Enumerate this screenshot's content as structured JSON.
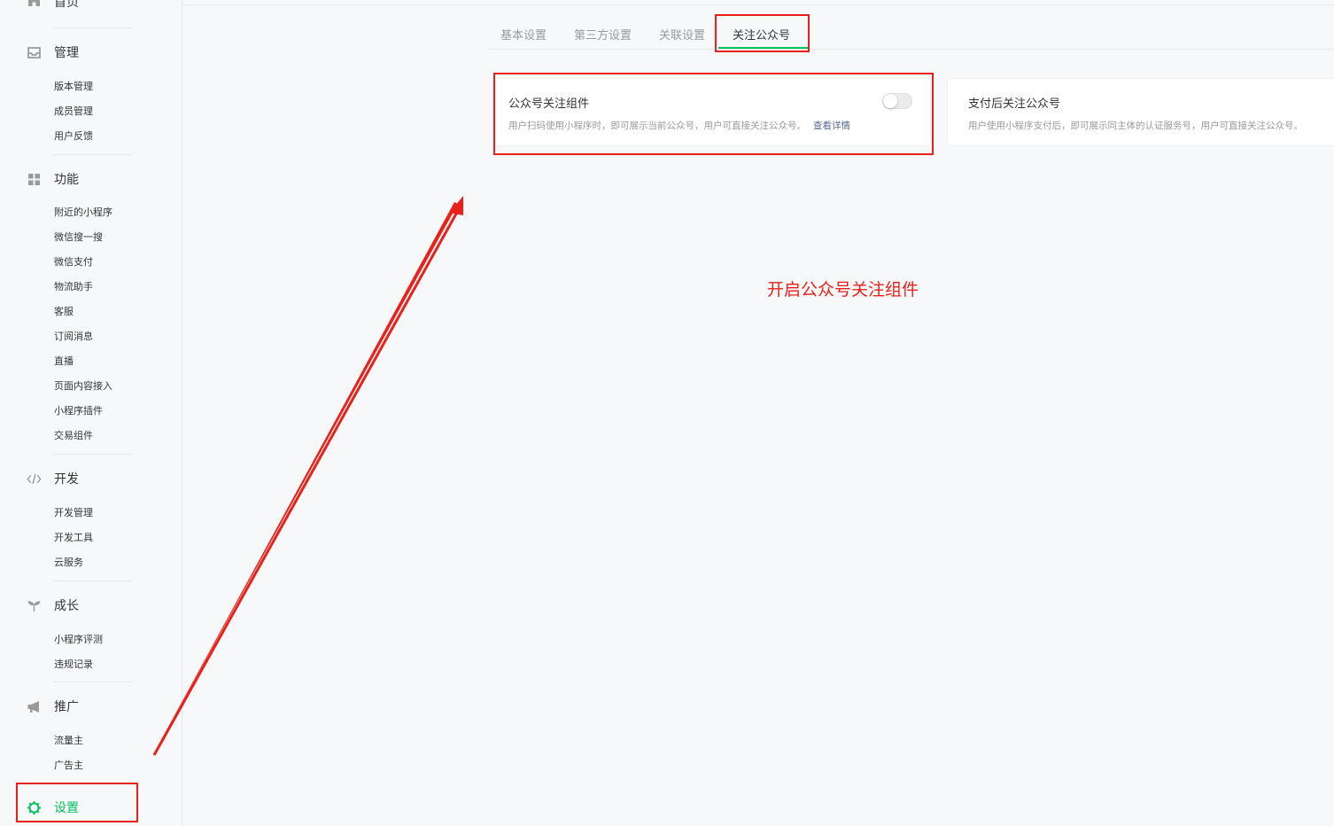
{
  "sidebar": {
    "home_label": "首页",
    "groups": [
      {
        "title": "管理",
        "icon": "inbox-icon",
        "items": [
          "版本管理",
          "成员管理",
          "用户反馈"
        ]
      },
      {
        "title": "功能",
        "icon": "grid-icon",
        "items": [
          "附近的小程序",
          "微信搜一搜",
          "微信支付",
          "物流助手",
          "客服",
          "订阅消息",
          "直播",
          "页面内容接入",
          "小程序插件",
          "交易组件"
        ]
      },
      {
        "title": "开发",
        "icon": "code-icon",
        "items": [
          "开发管理",
          "开发工具",
          "云服务"
        ]
      },
      {
        "title": "成长",
        "icon": "sprout-icon",
        "items": [
          "小程序评测",
          "违规记录"
        ]
      },
      {
        "title": "推广",
        "icon": "megaphone-icon",
        "items": [
          "流量主",
          "广告主"
        ]
      }
    ],
    "settings_label": "设置",
    "settings_icon": "gear-icon"
  },
  "tabs": [
    "基本设置",
    "第三方设置",
    "关联设置",
    "关注公众号"
  ],
  "active_tab": "关注公众号",
  "cards": [
    {
      "title": "公众号关注组件",
      "desc": "用户扫码使用小程序时，即可展示当前公众号，用户可直接关注公众号。",
      "link": "查看详情",
      "toggle_on": false
    },
    {
      "title": "支付后关注公众号",
      "desc": "用户使用小程序支付后，即可展示同主体的认证服务号，用户可直接关注公众号。"
    }
  ],
  "annotation": "开启公众号关注组件",
  "colors": {
    "accent": "#07c160",
    "annotation_red": "#e8221b",
    "link": "#576b95"
  }
}
